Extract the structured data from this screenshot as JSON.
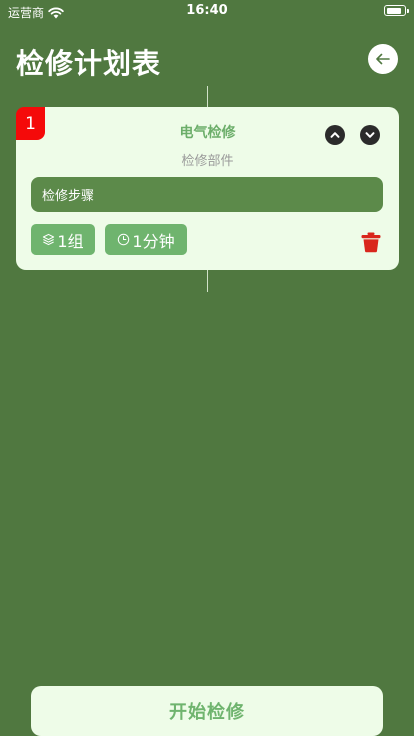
{
  "status_bar": {
    "carrier": "运营商",
    "time": "16:40",
    "battery_level": 0.85
  },
  "header": {
    "title": "检修计划表",
    "back_icon": "arrow-left-icon"
  },
  "plan_item": {
    "index": "1",
    "title": "电气检修",
    "subtitle": "检修部件",
    "steps_text": "检修步骤",
    "sets_label": "1组",
    "duration_label": "1分钟",
    "icons": [
      "chevron-up-icon",
      "chevron-down-icon",
      "layers-icon",
      "clock-icon",
      "trash-icon"
    ]
  },
  "footer": {
    "start_label": "开始检修"
  },
  "colors": {
    "background": "#507840",
    "card": "#eefce8",
    "accent": "#6fb46e",
    "badge": "#f50a0a",
    "delete": "#d9261c",
    "steps_field": "#5c8a4a"
  }
}
